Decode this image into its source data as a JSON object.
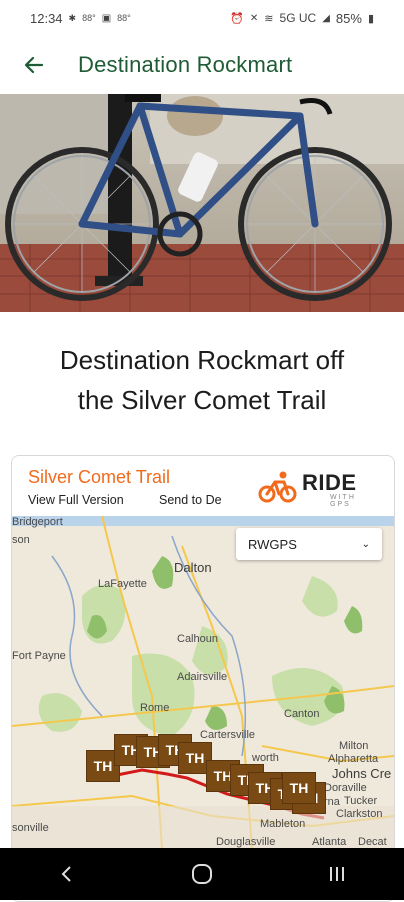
{
  "status": {
    "time": "12:34",
    "temp1": "88°",
    "temp2": "88°",
    "network": "5G UC",
    "battery": "85%"
  },
  "app_bar": {
    "title": "Destination Rockmart"
  },
  "hero": {
    "alt": "Blue road bicycle parked by a post"
  },
  "article": {
    "title_line1": "Destination Rockmart off",
    "title_line2": "the Silver Comet Trail"
  },
  "embed": {
    "route_name": "Silver Comet Trail",
    "view_full": "View Full Version",
    "send_to": "Send to De",
    "logo_text": "RIDE",
    "logo_sub": "WITH GPS",
    "layer_select": "RWGPS"
  },
  "map": {
    "labels": [
      "Bridgeport",
      "son",
      "LaFayette",
      "Dalton",
      "Calhoun",
      "Fort Payne",
      "Adairsville",
      "Rome",
      "Canton",
      "Cartersville",
      "Milton",
      "Alpharetta",
      "Johns Cre",
      "worth",
      "Doraville",
      "Tucker",
      "Clarkston",
      "Smyrna",
      "Mableton",
      "sonville",
      "Douglasville",
      "Atlanta",
      "Decat"
    ],
    "markers": [
      "TH",
      "TH",
      "TH",
      "TH",
      "TH",
      "TH",
      "TH",
      "TH",
      "TH",
      "TH",
      "TH"
    ]
  },
  "colors": {
    "brand_green": "#1f5b34",
    "route_orange": "#f26a1b",
    "route_red": "#d21a1a",
    "marker_brown": "#7a4a14"
  }
}
